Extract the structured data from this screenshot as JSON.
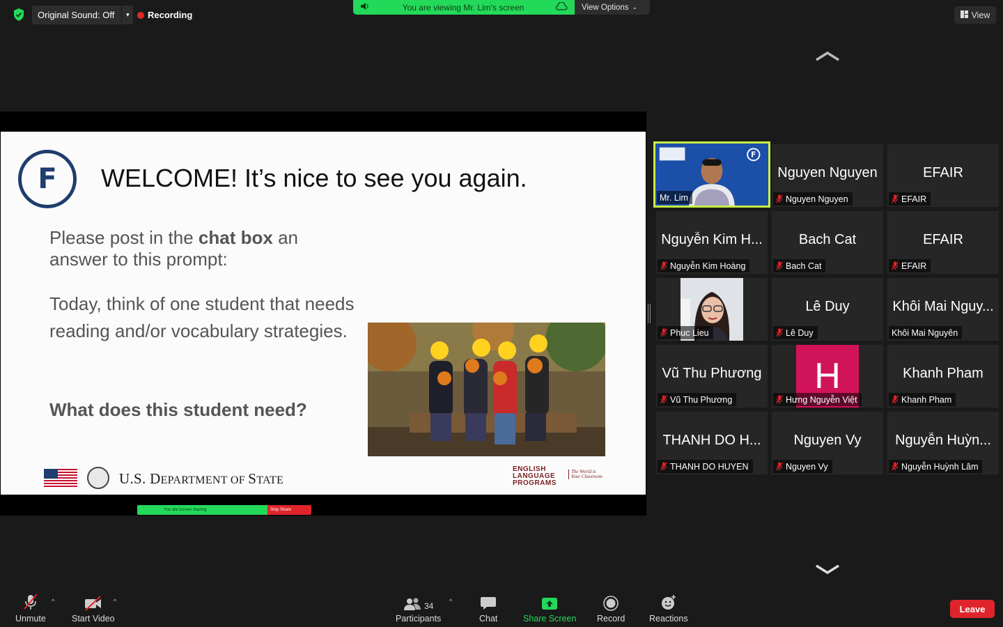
{
  "top_bar": {
    "original_sound": "Original Sound: Off",
    "recording": "Recording",
    "viewing_banner": "You are viewing Mr. Lim's screen",
    "view_options": "View Options",
    "view_button": "View"
  },
  "slide": {
    "logo_letter": "F",
    "title": "WELCOME! It’s nice to see you again.",
    "prompt_pre": "Please post in the ",
    "prompt_bold": "chat box",
    "prompt_post": " an answer to this prompt:",
    "body": "Today, think of one student that needs reading and/or vocabulary strategies.",
    "question": "What does this student need?",
    "footer_us": "U.S. D",
    "footer_epartment": "EPARTMENT",
    "footer_of": " OF ",
    "footer_s": "S",
    "footer_tate": "TATE",
    "elp_line1": "ENGLISH",
    "elp_line2": "LANGUAGE",
    "elp_line3": "PROGRAMS",
    "elp_tag1": "The World is",
    "elp_tag2": "Your Classroom"
  },
  "mini_share_bar": {
    "text": "You are screen sharing",
    "stop": "Stop Share"
  },
  "tiles": [
    {
      "big": "",
      "name": "Mr. Lim",
      "muted": false,
      "active": true,
      "type": "video"
    },
    {
      "big": "Nguyen Nguyen",
      "name": "Nguyen Nguyen",
      "muted": true
    },
    {
      "big": "EFAIR",
      "name": "EFAIR",
      "muted": true
    },
    {
      "big": "Nguyễn Kim H...",
      "name": "Nguyễn Kim Hoàng",
      "muted": true
    },
    {
      "big": "Bach Cat",
      "name": "Bach Cat",
      "muted": true
    },
    {
      "big": "EFAIR",
      "name": "EFAIR",
      "muted": true
    },
    {
      "big": "",
      "name": "Phuc Lieu",
      "muted": true,
      "type": "photo"
    },
    {
      "big": "Lê Duy",
      "name": "Lê Duy",
      "muted": true
    },
    {
      "big": "Khôi Mai Nguy...",
      "name": "Khôi Mai Nguyên",
      "muted": false
    },
    {
      "big": "Vũ Thu Phương",
      "name": "Vũ Thu Phương",
      "muted": true
    },
    {
      "big": "H",
      "name": "Hưng Nguyễn Việt",
      "muted": true,
      "type": "avatar"
    },
    {
      "big": "Khanh Pham",
      "name": "Khanh Pham",
      "muted": true
    },
    {
      "big": "THANH DO H...",
      "name": "THANH DO HUYEN",
      "muted": true
    },
    {
      "big": "Nguyen Vy",
      "name": "Nguyen Vy",
      "muted": true
    },
    {
      "big": "Nguyễn Huỳn...",
      "name": "Nguyễn Huỳnh Lâm",
      "muted": true
    }
  ],
  "toolbar": {
    "unmute": "Unmute",
    "start_video": "Start Video",
    "participants": "Participants",
    "participant_count": "34",
    "chat": "Chat",
    "share_screen": "Share Screen",
    "record": "Record",
    "reactions": "Reactions",
    "leave": "Leave"
  },
  "colors": {
    "green": "#23d959",
    "red": "#e0242b",
    "active_border": "#c8f046",
    "avatar_pink": "#d1145a"
  }
}
